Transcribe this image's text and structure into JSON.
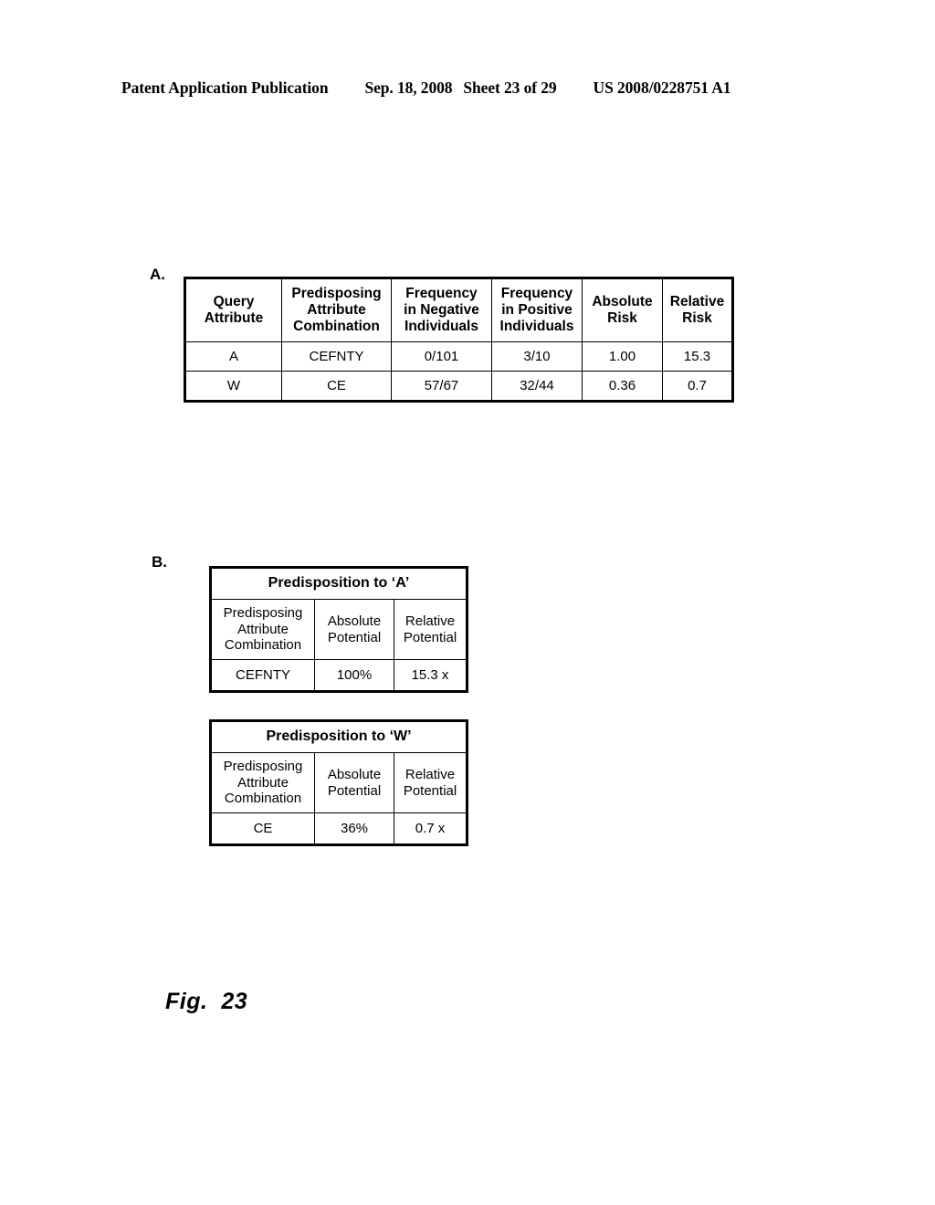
{
  "page_header": {
    "publication": "Patent Application Publication",
    "date": "Sep. 18, 2008",
    "sheet": "Sheet 23 of 29",
    "document_number": "US 2008/0228751 A1"
  },
  "panels": {
    "a_label": "A.",
    "b_label": "B."
  },
  "table_a": {
    "columns": [
      "Query\nAttribute",
      "Predisposing\nAttribute\nCombination",
      "Frequency\nin Negative\nIndividuals",
      "Frequency\nin Positive\nIndividuals",
      "Absolute\nRisk",
      "Relative\nRisk"
    ],
    "rows": [
      {
        "query_attribute": "A",
        "predisposing_attribute_combination": "CEFNTY",
        "frequency_in_negative_individuals": "0/101",
        "frequency_in_positive_individuals": "3/10",
        "absolute_risk": "1.00",
        "relative_risk": "15.3"
      },
      {
        "query_attribute": "W",
        "predisposing_attribute_combination": "CE",
        "frequency_in_negative_individuals": "57/67",
        "frequency_in_positive_individuals": "32/44",
        "absolute_risk": "0.36",
        "relative_risk": "0.7"
      }
    ]
  },
  "table_b1": {
    "title": "Predisposition to ‘A’",
    "columns": [
      "Predisposing\nAttribute\nCombination",
      "Absolute\nPotential",
      "Relative\nPotential"
    ],
    "rows": [
      {
        "predisposing_attribute_combination": "CEFNTY",
        "absolute_potential": "100%",
        "relative_potential": "15.3 x"
      }
    ]
  },
  "table_b2": {
    "title": "Predisposition to ‘W’",
    "columns": [
      "Predisposing\nAttribute\nCombination",
      "Absolute\nPotential",
      "Relative\nPotential"
    ],
    "rows": [
      {
        "predisposing_attribute_combination": "CE",
        "absolute_potential": "36%",
        "relative_potential": "0.7 x"
      }
    ]
  },
  "figure": {
    "caption": "Fig.  23"
  }
}
